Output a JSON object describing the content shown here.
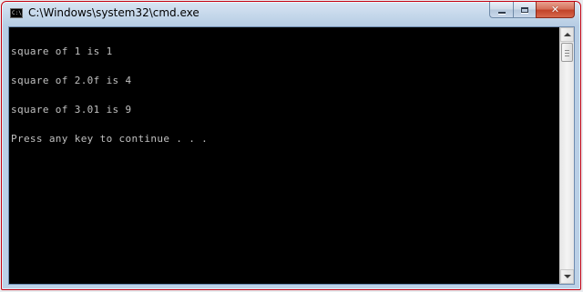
{
  "window": {
    "title": "C:\\Windows\\system32\\cmd.exe",
    "app_icon": "command-prompt-icon",
    "app_icon_text": "C:\\",
    "border_color": "#c40010"
  },
  "caption_buttons": {
    "minimize": "minimize-icon",
    "maximize": "maximize-icon",
    "close": "close-icon",
    "close_glyph": "✕"
  },
  "console": {
    "background": "#000000",
    "foreground": "#c0c0c0",
    "lines": [
      "square of 1 is 1",
      "square of 2.0f is 4",
      "square of 3.01 is 9",
      "Press any key to continue . . ."
    ]
  },
  "scrollbar": {
    "up_arrow": "scroll-up-arrow-icon",
    "down_arrow": "scroll-down-arrow-icon",
    "position": 0
  }
}
